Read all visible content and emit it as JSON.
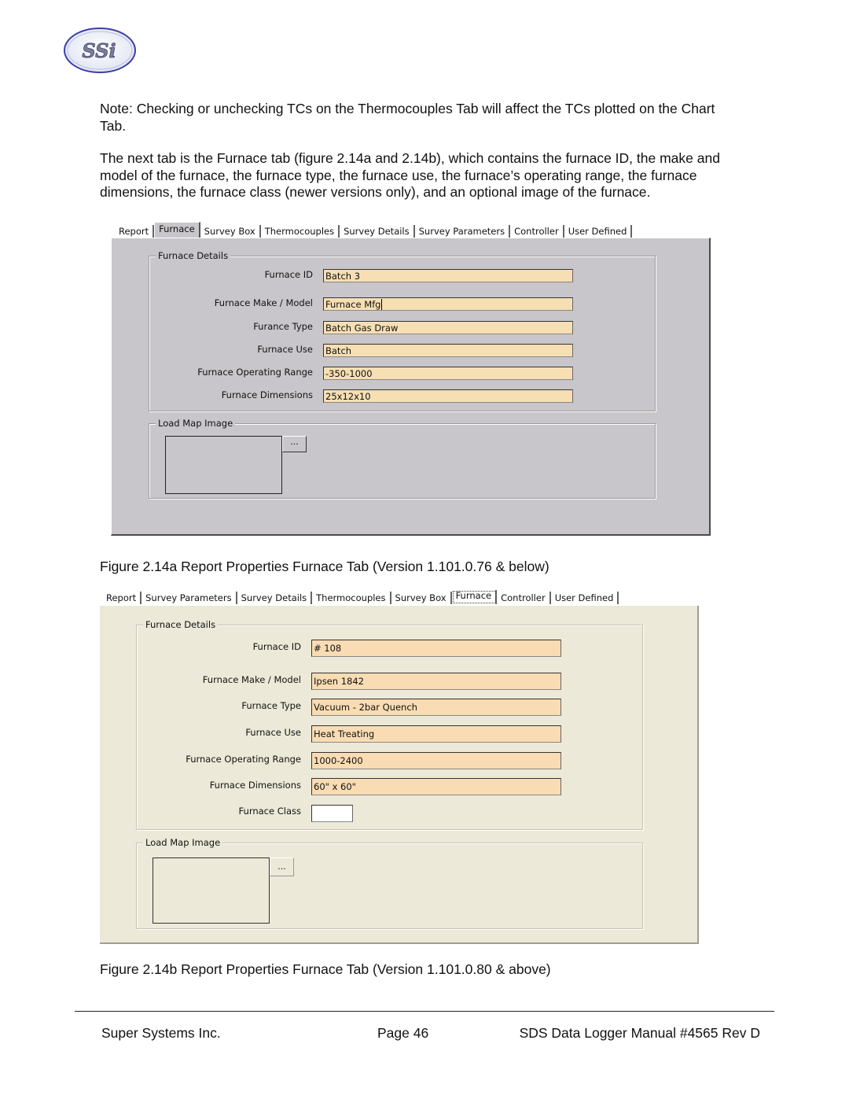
{
  "logo": {
    "text": "SSi"
  },
  "paragraphs": {
    "note": "Note: Checking or unchecking TCs on the Thermocouples Tab will affect the TCs plotted on the Chart Tab.",
    "intro": "The next tab is the Furnace tab (figure 2.14a and 2.14b), which contains the furnace ID, the make and model of the furnace, the furnace type, the furnace use, the furnace’s operating range, the furnace dimensions, the furnace class (newer versions only), and an optional image of the furnace."
  },
  "figure_a": {
    "tabs": [
      "Report",
      "Furnace",
      "Survey Box",
      "Thermocouples",
      "Survey Details",
      "Survey Parameters",
      "Controller",
      "User Defined"
    ],
    "active_tab": "Furnace",
    "details_legend": "Furnace Details",
    "fields": [
      {
        "label": "Furnace ID",
        "value": "Batch 3"
      },
      {
        "label": "Furnace Make / Model",
        "value": "Furnace Mfg"
      },
      {
        "label": "Furance Type",
        "value": "Batch Gas Draw"
      },
      {
        "label": "Furnace Use",
        "value": "Batch"
      },
      {
        "label": "Furnace Operating Range",
        "value": "-350-1000"
      },
      {
        "label": "Furnace Dimensions",
        "value": "25x12x10"
      }
    ],
    "map_legend": "Load Map Image",
    "browse_label": "...",
    "caption": "Figure 2.14a Report Properties Furnace Tab (Version 1.101.0.76 & below)"
  },
  "figure_b": {
    "tabs": [
      "Report",
      "Survey Parameters",
      "Survey Details",
      "Thermocouples",
      "Survey Box",
      "Furnace",
      "Controller",
      "User Defined"
    ],
    "active_tab": "Furnace",
    "details_legend": "Furnace Details",
    "fields": [
      {
        "label": "Furnace ID",
        "value": "# 108"
      },
      {
        "label": "Furnace Make / Model",
        "value": "Ipsen 1842"
      },
      {
        "label": "Furnace Type",
        "value": "Vacuum - 2bar Quench"
      },
      {
        "label": "Furnace Use",
        "value": "Heat Treating"
      },
      {
        "label": "Furnace Operating Range",
        "value": "1000-2400"
      },
      {
        "label": "Furnace Dimensions",
        "value": "60\" x 60\""
      },
      {
        "label": "Furnace Class",
        "value": ""
      }
    ],
    "map_legend": "Load Map Image",
    "browse_label": "...",
    "caption": "Figure 2.14b Report Properties Furnace Tab (Version 1.101.0.80 & above)"
  },
  "footer": {
    "company": "Super Systems Inc.",
    "page": "Page 46",
    "manual": "SDS Data Logger Manual #4565 Rev D"
  }
}
